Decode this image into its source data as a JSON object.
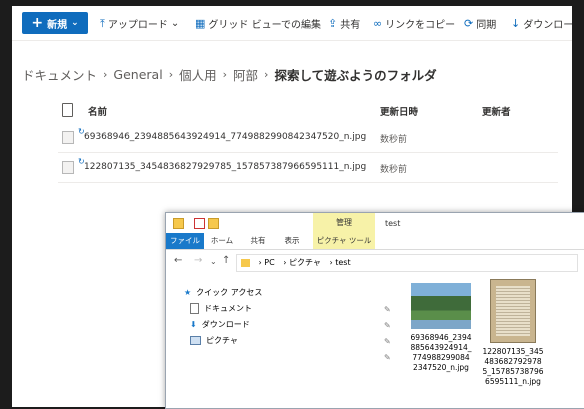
{
  "toolbar": {
    "new_label": "新規",
    "upload_label": "アップロード",
    "grid_label": "グリッド ビューでの編集",
    "share_label": "共有",
    "copylink_label": "リンクをコピー",
    "sync_label": "同期",
    "download_label": "ダウンロード"
  },
  "breadcrumb": [
    "ドキュメント",
    "General",
    "個人用",
    "阿部",
    "探索して遊ぶようのフォルダ"
  ],
  "list": {
    "col_name": "名前",
    "col_modified": "更新日時",
    "col_modified_by": "更新者",
    "rows": [
      {
        "name": "69368946_2394885643924914_7749882990842347520_n.jpg",
        "modified": "数秒前"
      },
      {
        "name": "122807135_3454836827929785_157857387966595111_n.jpg",
        "modified": "数秒前"
      }
    ]
  },
  "explorer": {
    "context_tab": "管理",
    "title": "test",
    "tabs": [
      "ファイル",
      "ホーム",
      "共有",
      "表示",
      "ピクチャ ツール"
    ],
    "path": [
      "PC",
      "ピクチャ",
      "test"
    ],
    "nav": [
      "クイック アクセス",
      "ドキュメント",
      "ダウンロード",
      "ピクチャ"
    ],
    "files": [
      "69368946_2394885643924914_7749882990842347520_n.jpg",
      "122807135_3454836827929785_157857387966595111_n.jpg"
    ]
  }
}
